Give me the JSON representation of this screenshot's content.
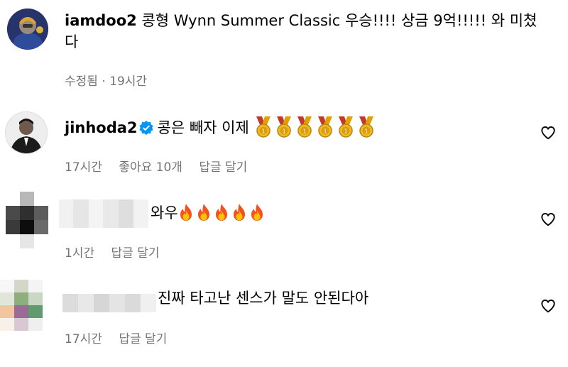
{
  "comments": [
    {
      "username": "iamdoo2",
      "text": "콩형 Wynn Summer Classic 우승!!!! 상금 9억!!!!! 와 미쳤다",
      "meta": [
        "수정됨 · 19시간"
      ],
      "liked_icon": "heart-outline-icon"
    },
    {
      "username": "jinhoda2",
      "verified": true,
      "text": "콩은 빼자 이제",
      "emoji": "medal-icon",
      "emoji_count": 6,
      "meta": [
        "17시간",
        "좋아요 10개",
        "답글 달기"
      ],
      "liked_icon": "heart-outline-icon"
    },
    {
      "username": "",
      "text": "와우",
      "emoji": "fire-icon",
      "emoji_count": 5,
      "meta": [
        "1시간",
        "답글 달기"
      ],
      "liked_icon": "heart-outline-icon"
    },
    {
      "username": "",
      "text": "진짜 타고난 센스가 말도 안된다아",
      "meta": [
        "17시간",
        "답글 달기"
      ],
      "liked_icon": "heart-outline-icon"
    }
  ],
  "colors": {
    "meta_gray": "#737373",
    "verified_blue": "#0095f6"
  }
}
